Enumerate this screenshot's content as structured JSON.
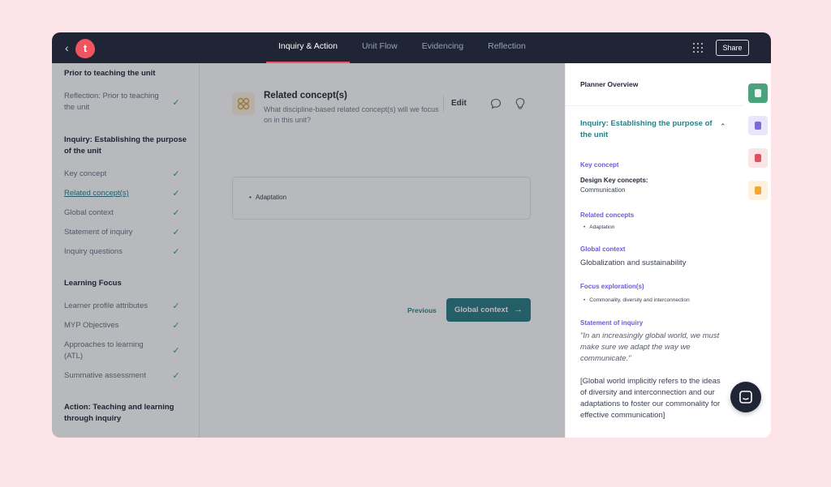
{
  "topbar": {
    "back_glyph": "‹",
    "logo_letter": "t",
    "tabs": [
      {
        "label": "Inquiry & Action",
        "active": true
      },
      {
        "label": "Unit Flow",
        "active": false
      },
      {
        "label": "Evidencing",
        "active": false
      },
      {
        "label": "Reflection",
        "active": false
      }
    ],
    "share_label": "Share"
  },
  "sidebar": {
    "sections": [
      {
        "title": "Prior to teaching the unit",
        "items": [
          {
            "label": "Reflection: Prior to teaching the unit",
            "done": true
          }
        ]
      },
      {
        "title": "Inquiry: Establishing the purpose of the unit",
        "items": [
          {
            "label": "Key concept",
            "done": true
          },
          {
            "label": "Related concept(s)",
            "done": true,
            "active": true
          },
          {
            "label": "Global context",
            "done": true
          },
          {
            "label": "Statement of inquiry",
            "done": true
          },
          {
            "label": "Inquiry questions",
            "done": true
          }
        ]
      },
      {
        "title": "Learning Focus",
        "items": [
          {
            "label": "Learner profile attributes",
            "done": true
          },
          {
            "label": "MYP Objectives",
            "done": true
          },
          {
            "label": "Approaches to learning (ATL)",
            "done": true
          },
          {
            "label": "Summative assessment",
            "done": true
          }
        ]
      },
      {
        "title": "Action: Teaching and learning through inquiry",
        "items": []
      }
    ]
  },
  "main": {
    "title": "Related concept(s)",
    "question": "What discipline-based related concept(s) will we focus on in this unit?",
    "edit_label": "Edit",
    "answers": [
      "Adaptation"
    ],
    "previous_label": "Previous",
    "next_label": "Global context",
    "next_arrow": "→"
  },
  "panel": {
    "title": "Planner Overview",
    "section_title": "Inquiry: Establishing the purpose of the unit",
    "collapse_glyph": "⌃",
    "key_concept_label": "Key concept",
    "key_concept_heading": "Design Key concepts:",
    "key_concept_value": "Communication",
    "related_label": "Related concepts",
    "related_items": [
      "Adaptation"
    ],
    "global_label": "Global context",
    "global_value": "Globalization and sustainability",
    "focus_label": "Focus exploration(s)",
    "focus_items": [
      "Commonality, diversity and interconnection"
    ],
    "soi_label": "Statement of inquiry",
    "soi_quote": "\"In an increasingly global world, we must make sure we adapt the way we communicate.\"",
    "soi_note": "[Global world implicitly refers to the ideas of diversity and interconnection and our adaptations to foster our commonality for effective communication]"
  },
  "rail": {
    "buttons": [
      {
        "name": "notes-icon",
        "color": "#4aa37d"
      },
      {
        "name": "planner-icon",
        "color": "#e9e6fb"
      },
      {
        "name": "clipboard-icon",
        "color": "#fbe4e6"
      },
      {
        "name": "archive-icon",
        "color": "#fdf2dd"
      }
    ]
  },
  "colors": {
    "accent": "#ee5561",
    "teal": "#2b7d85",
    "purple_label": "#6a5cd6",
    "topbar_bg": "#1f2535"
  }
}
